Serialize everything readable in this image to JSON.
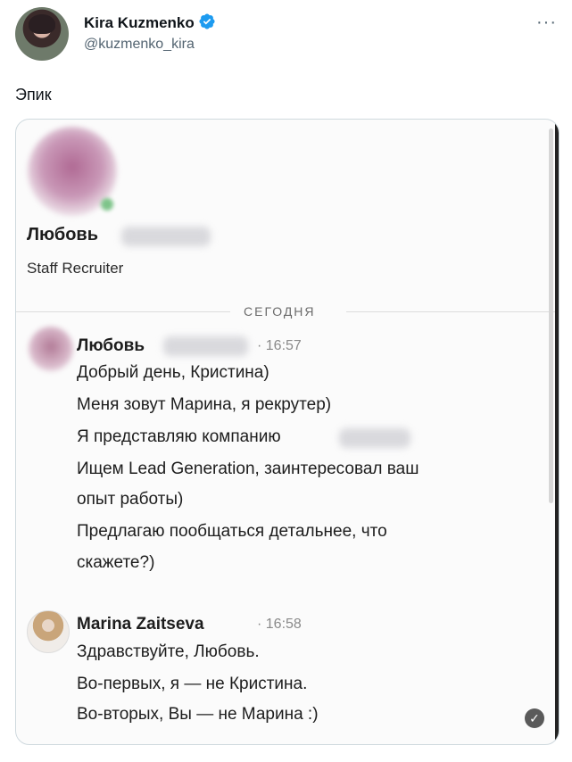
{
  "tweet": {
    "author_name": "Kira Kuzmenko",
    "author_handle": "@kuzmenko_kira",
    "more_label": "···",
    "text": "Эпик"
  },
  "card": {
    "profile": {
      "name": "Любовь",
      "title": "Staff Recruiter"
    },
    "day_separator": "СЕГОДНЯ",
    "messages": [
      {
        "sender": "Любовь",
        "time": "· 16:57",
        "lines": [
          "Добрый день, Кристина)",
          "Меня зовут Марина, я рекрутер)",
          "Я представляю компанию",
          "Ищем Lead Generation, заинтересовал ваш",
          "опыт работы)",
          "Предлагаю пообщаться детальнее, что",
          "скажете?)"
        ]
      },
      {
        "sender": "Marina Zaitseva",
        "time": "· 16:58",
        "lines": [
          "Здравствуйте, Любовь.",
          "Во-первых, я — не Кристина.",
          "Во-вторых, Вы — не Марина :)"
        ]
      }
    ],
    "read_icon": "✓"
  },
  "colors": {
    "verified_blue": "#1d9bf0",
    "muted_text": "#536471"
  }
}
